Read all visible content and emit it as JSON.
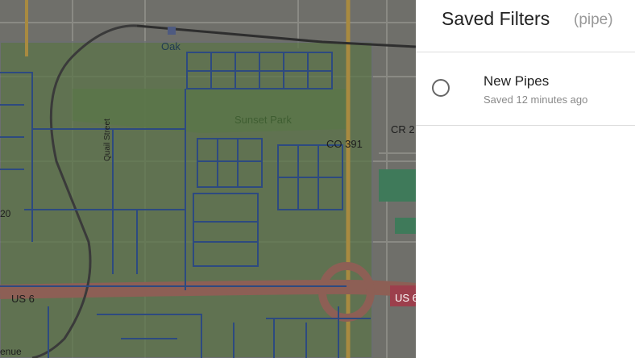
{
  "map": {
    "labels": {
      "oak": "Oak",
      "sunset_park": "Sunset Park",
      "co391": "CO 391",
      "cr2": "CR 2",
      "us6_left": "US 6",
      "us6_right": "US 6",
      "quail_street": "Quail Street",
      "road_20": "20",
      "avenue": "enue"
    }
  },
  "panel": {
    "title": "Saved Filters",
    "subtitle": "(pipe)",
    "filters": [
      {
        "name": "New Pipes",
        "meta": "Saved 12 minutes ago"
      }
    ]
  }
}
